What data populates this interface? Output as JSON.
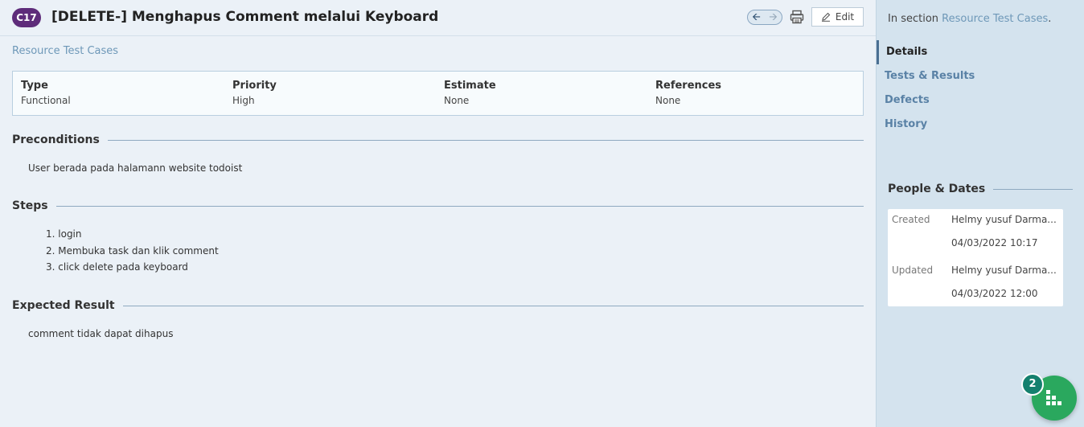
{
  "header": {
    "case_id": "C17",
    "title": "[DELETE-] Menghapus Comment melalui Keyboard",
    "edit_label": "Edit"
  },
  "breadcrumb": "Resource Test Cases",
  "info": {
    "type_label": "Type",
    "type_value": "Functional",
    "priority_label": "Priority",
    "priority_value": "High",
    "estimate_label": "Estimate",
    "estimate_value": "None",
    "references_label": "References",
    "references_value": "None"
  },
  "preconditions": {
    "title": "Preconditions",
    "text": "User berada pada halamann website todoist"
  },
  "steps": {
    "title": "Steps",
    "items": [
      "login",
      "Membuka task dan klik comment",
      "click delete pada keyboard"
    ]
  },
  "expected": {
    "title": "Expected Result",
    "text": "comment tidak dapat dihapus"
  },
  "sidebar": {
    "in_section_prefix": "In section",
    "section_link": "Resource Test Cases",
    "in_section_suffix": ".",
    "nav": [
      "Details",
      "Tests & Results",
      "Defects",
      "History"
    ],
    "people_title": "People & Dates",
    "created_label": "Created",
    "created_by": "Helmy yusuf Darma...",
    "created_date": "04/03/2022 10:17",
    "updated_label": "Updated",
    "updated_by": "Helmy yusuf Darma...",
    "updated_date": "04/03/2022 12:00"
  },
  "widget": {
    "badge_count": "2"
  },
  "colors": {
    "badge": "#5e2c7a",
    "link": "#6e98b8",
    "widget": "#2aa85e"
  }
}
